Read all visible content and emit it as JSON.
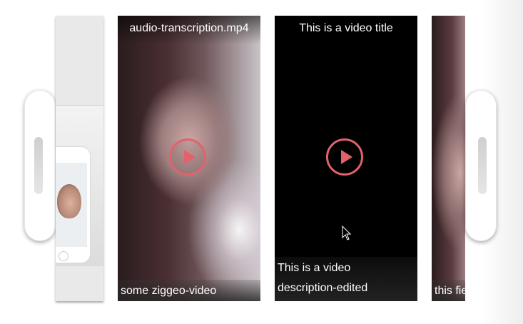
{
  "carousel": {
    "prev_button": {
      "icon": "chevron-left-icon"
    },
    "next_button": {
      "icon": "chevron-right-icon"
    },
    "items": [
      {
        "title": "",
        "description": ""
      },
      {
        "title": "audio-transcription.mp4",
        "description": "some ziggeo-video"
      },
      {
        "title": "This is a video title",
        "description_line1": "This is a video",
        "description_line2": "description-edited"
      },
      {
        "title": "",
        "description": "this fie"
      }
    ],
    "play_icon": "play-icon"
  },
  "colors": {
    "accent": "#e2626c",
    "tile_dark": "#000000",
    "text": "#ffffff"
  }
}
